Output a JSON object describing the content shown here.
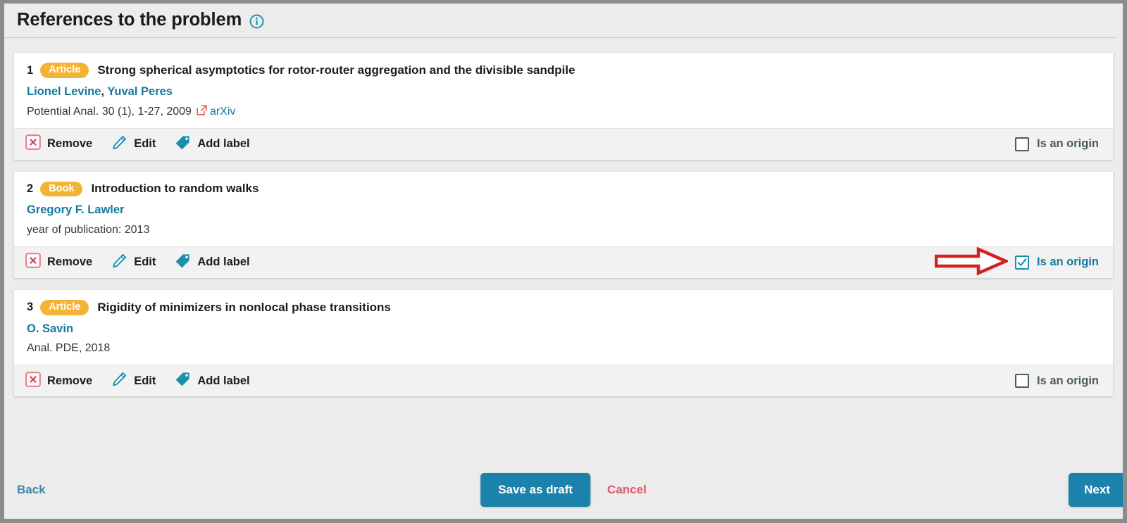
{
  "header": {
    "title": "References to the problem",
    "info_icon": "info-circle-icon"
  },
  "references": [
    {
      "index": "1",
      "badge": "Article",
      "title": "Strong spherical asymptotics for rotor-router aggregation and the divisible sandpile",
      "authors": [
        "Lionel Levine",
        "Yuval Peres"
      ],
      "authors_separator": ", ",
      "meta": "Potential Anal. 30 (1), 1-27, 2009",
      "external_link": "arXiv",
      "external_icon": "external-link-icon",
      "actions": {
        "remove": "Remove",
        "edit": "Edit",
        "add_label": "Add label"
      },
      "origin_label": "Is an origin",
      "origin_checked": false,
      "has_annotation_arrow": false
    },
    {
      "index": "2",
      "badge": "Book",
      "title": "Introduction to random walks",
      "authors": [
        "Gregory F. Lawler"
      ],
      "authors_separator": ", ",
      "meta": "year of publication: 2013",
      "external_link": "",
      "external_icon": "",
      "actions": {
        "remove": "Remove",
        "edit": "Edit",
        "add_label": "Add label"
      },
      "origin_label": "Is an origin",
      "origin_checked": true,
      "has_annotation_arrow": true
    },
    {
      "index": "3",
      "badge": "Article",
      "title": "Rigidity of minimizers in nonlocal phase transitions",
      "authors": [
        "O. Savin"
      ],
      "authors_separator": ", ",
      "meta": "Anal. PDE, 2018",
      "external_link": "",
      "external_icon": "",
      "actions": {
        "remove": "Remove",
        "edit": "Edit",
        "add_label": "Add label"
      },
      "origin_label": "Is an origin",
      "origin_checked": false,
      "has_annotation_arrow": false
    }
  ],
  "footer": {
    "back": "Back",
    "save_as_draft": "Save as draft",
    "cancel": "Cancel",
    "next": "Next"
  },
  "colors": {
    "accent_teal": "#1a82ab",
    "link_blue": "#1479a0",
    "badge_amber": "#f5b335",
    "danger_red": "#e0596b",
    "annotation_red": "#d62020",
    "page_bg": "#ececec",
    "card_bg": "#ffffff",
    "action_bar_bg": "#f2f2f2"
  },
  "icons": {
    "remove": "remove-x-box-icon",
    "edit": "edit-pencil-icon",
    "add_label": "tag-icon",
    "checkbox": "checkbox-icon",
    "checkbox_checked": "checkbox-checked-icon",
    "annotation": "red-arrow-annotation"
  }
}
